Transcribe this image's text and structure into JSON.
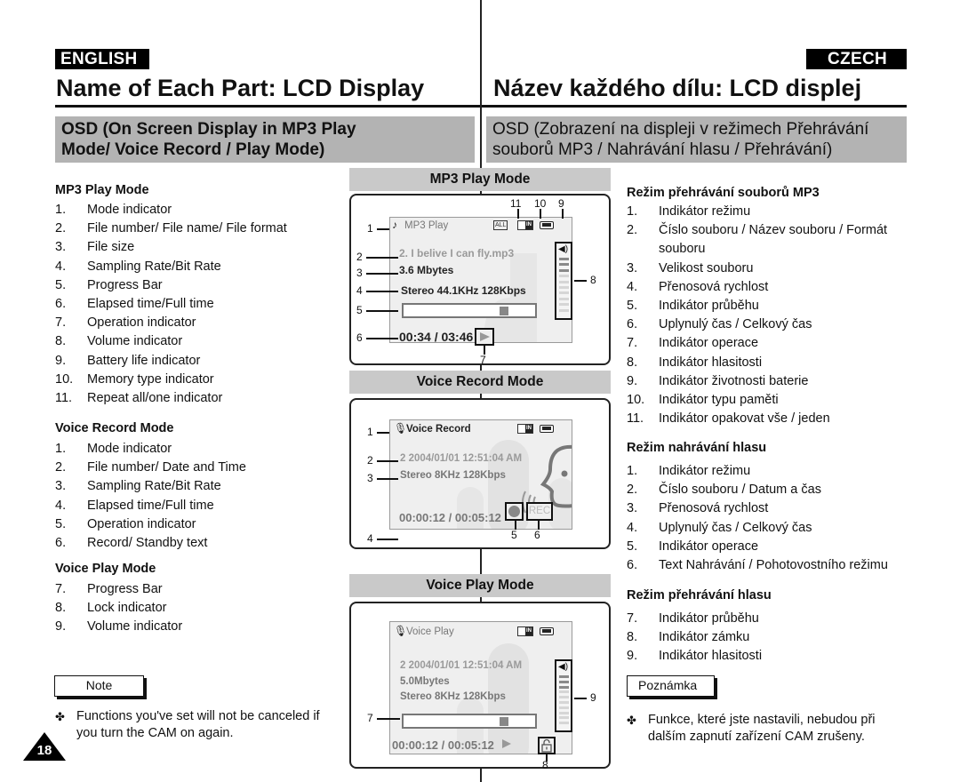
{
  "badges": {
    "english": "ENGLISH",
    "czech": "CZECH"
  },
  "titles": {
    "english": "Name of Each Part: LCD Display",
    "czech": "Název každého dílu: LCD displej"
  },
  "osd": {
    "english": [
      "OSD (On Screen Display in MP3 Play",
      "Mode/ Voice Record / Play Mode)"
    ],
    "czech": [
      "OSD (Zobrazení na displeji v režimech Přehrávání",
      "souborů MP3 / Nahrávání hlasu / Přehrávání)"
    ]
  },
  "english": {
    "mp3_heading": "MP3 Play Mode",
    "mp3_items": [
      {
        "n": "1.",
        "t": "Mode indicator"
      },
      {
        "n": "2.",
        "t": "File number/ File name/ File format"
      },
      {
        "n": "3.",
        "t": "File size"
      },
      {
        "n": "4.",
        "t": "Sampling Rate/Bit Rate"
      },
      {
        "n": "5.",
        "t": "Progress Bar"
      },
      {
        "n": "6.",
        "t": "Elapsed time/Full time"
      },
      {
        "n": "7.",
        "t": "Operation indicator"
      },
      {
        "n": "8.",
        "t": "Volume indicator"
      },
      {
        "n": "9.",
        "t": "Battery life indicator"
      },
      {
        "n": "10.",
        "t": "Memory type indicator"
      },
      {
        "n": "11.",
        "t": "Repeat all/one indicator"
      }
    ],
    "voice_record_heading": "Voice Record Mode",
    "voice_record_items": [
      {
        "n": "1.",
        "t": "Mode indicator"
      },
      {
        "n": "2.",
        "t": "File number/ Date and Time"
      },
      {
        "n": "3.",
        "t": "Sampling Rate/Bit Rate"
      },
      {
        "n": "4.",
        "t": "Elapsed time/Full time"
      },
      {
        "n": "5.",
        "t": "Operation indicator"
      },
      {
        "n": "6.",
        "t": "Record/ Standby text"
      }
    ],
    "voice_play_heading": "Voice Play Mode",
    "voice_play_items": [
      {
        "n": "7.",
        "t": "Progress Bar"
      },
      {
        "n": "8.",
        "t": "Lock indicator"
      },
      {
        "n": "9.",
        "t": "Volume indicator"
      }
    ],
    "note_label": "Note",
    "note_lines": [
      "Functions you've set will not be canceled if",
      "you turn the CAM on again."
    ]
  },
  "czech": {
    "mp3_heading": "Režim přehrávání souborů MP3",
    "mp3_items": [
      {
        "n": "1.",
        "t": "Indikátor režimu"
      },
      {
        "n": "2.",
        "t": "Číslo souboru / Název souboru / Formát souboru"
      },
      {
        "n": "3.",
        "t": "Velikost souboru"
      },
      {
        "n": "4.",
        "t": "Přenosová rychlost"
      },
      {
        "n": "5.",
        "t": "Indikátor průběhu"
      },
      {
        "n": "6.",
        "t": "Uplynulý čas / Celkový čas"
      },
      {
        "n": "7.",
        "t": "Indikátor operace"
      },
      {
        "n": "8.",
        "t": "Indikátor hlasitosti"
      },
      {
        "n": "9.",
        "t": "Indikátor životnosti baterie"
      },
      {
        "n": "10.",
        "t": "Indikátor typu paměti"
      },
      {
        "n": "11.",
        "t": "Indikátor opakovat vše / jeden"
      }
    ],
    "voice_record_heading": "Režim nahrávání hlasu",
    "voice_record_items": [
      {
        "n": "1.",
        "t": "Indikátor režimu"
      },
      {
        "n": "2.",
        "t": "Číslo souboru / Datum a čas"
      },
      {
        "n": "3.",
        "t": "Přenosová rychlost"
      },
      {
        "n": "4.",
        "t": "Uplynulý čas / Celkový čas"
      },
      {
        "n": "5.",
        "t": "Indikátor operace"
      },
      {
        "n": "6.",
        "t": "Text Nahrávání / Pohotovostního režimu"
      }
    ],
    "voice_play_heading": "Režim přehrávání hlasu",
    "voice_play_items": [
      {
        "n": "7.",
        "t": "Indikátor průběhu"
      },
      {
        "n": "8.",
        "t": "Indikátor zámku"
      },
      {
        "n": "9.",
        "t": "Indikátor hlasitosti"
      }
    ],
    "note_label": "Poznámka",
    "note_lines": [
      "Funkce, které jste nastavili, nebudou při",
      "dalším zapnutí zařízení CAM zrušeny."
    ]
  },
  "diagrams": {
    "mp3": {
      "header": "MP3 Play Mode",
      "mode": "MP3 Play",
      "file": "2.  I belive I can fly.mp3",
      "size": "3.6 Mbytes",
      "rate": "Stereo 44.1KHz 128Kbps",
      "time": "00:34 / 03:46",
      "repeat_label": "ALL",
      "memory_label": "IN",
      "progress_fraction": 0.82,
      "volume_level": 3,
      "volume_max": 10,
      "callouts": [
        "1",
        "2",
        "3",
        "4",
        "5",
        "6",
        "7",
        "8",
        "9",
        "10",
        "11"
      ]
    },
    "voice_record": {
      "header": "Voice Record Mode",
      "mode": "Voice Record",
      "file": "2  2004/01/01  12:51:04 AM",
      "rate": "Stereo  8KHz  128Kbps",
      "time": "00:00:12 / 00:05:12",
      "rec_label": "REC",
      "memory_label": "IN",
      "callouts": [
        "1",
        "2",
        "3",
        "4",
        "5",
        "6"
      ]
    },
    "voice_play": {
      "header": "Voice Play Mode",
      "mode": "Voice Play",
      "file": "2  2004/01/01  12:51:04 AM",
      "size": "5.0Mbytes",
      "rate": "Stereo  8KHz  128Kbps",
      "time": "00:00:12 / 00:05:12",
      "memory_label": "IN",
      "progress_fraction": 0.82,
      "volume_level": 3,
      "volume_max": 10,
      "callouts": [
        "7",
        "8",
        "9"
      ]
    }
  },
  "page_number": "18"
}
